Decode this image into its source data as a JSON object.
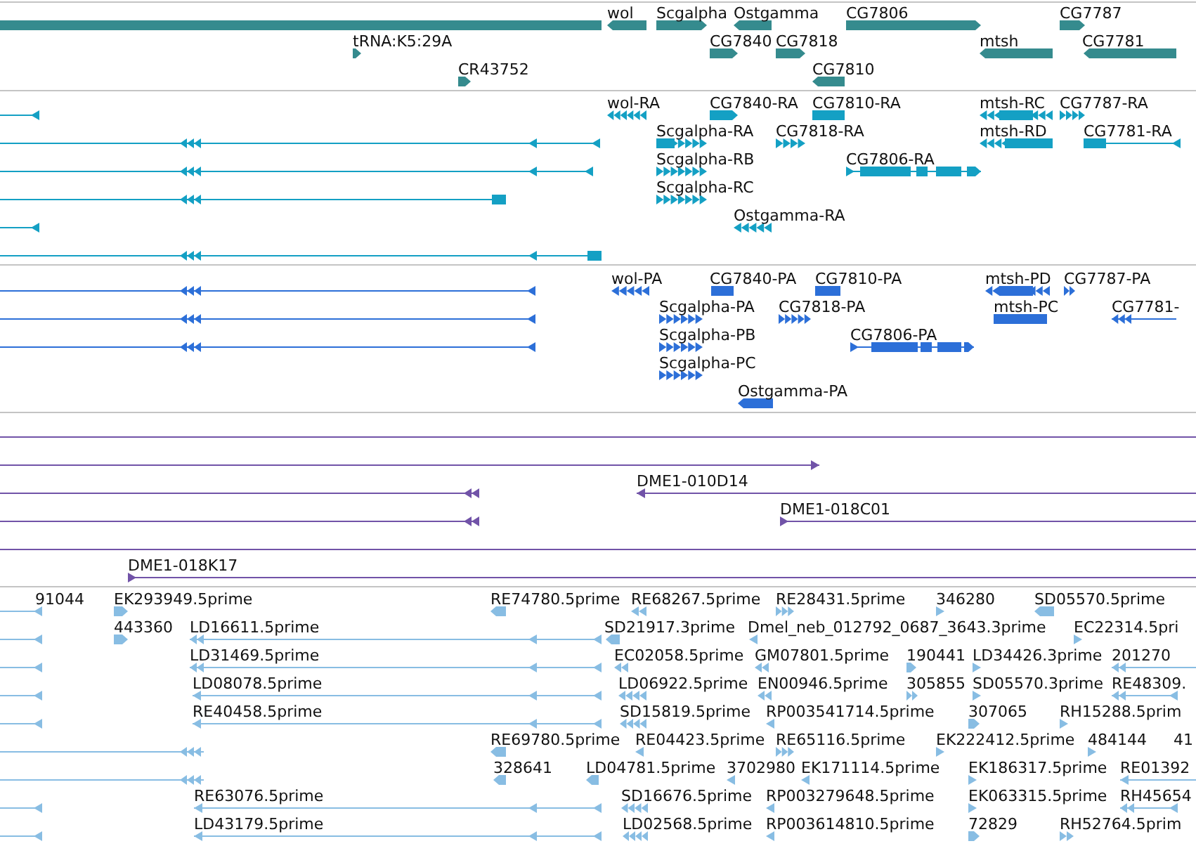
{
  "tracks": [
    {
      "color": "#358b8e",
      "labels": [
        "wol",
        "Scgalpha",
        "Ostgamma",
        "CG7806",
        "CG7787",
        "tRNA:K5:29A",
        "CG7840",
        "CG7818",
        "mtsh",
        "CG7781",
        "CR43752",
        "CG7810"
      ]
    },
    {
      "color": "#14a0c4",
      "labels": [
        "wol-RA",
        "CG7840-RA",
        "CG7810-RA",
        "mtsh-RC",
        "CG7787-RA",
        "Scgalpha-RA",
        "CG7818-RA",
        "mtsh-RD",
        "CG7781-RA",
        "Scgalpha-RB",
        "CG7806-RA",
        "Scgalpha-RC",
        "Ostgamma-RA"
      ]
    },
    {
      "color": "#2c6fd8",
      "labels": [
        "wol-PA",
        "CG7840-PA",
        "CG7810-PA",
        "mtsh-PD",
        "CG7787-PA",
        "Scgalpha-PA",
        "CG7818-PA",
        "mtsh-PC",
        "CG7781-",
        "Scgalpha-PB",
        "CG7806-PA",
        "Scgalpha-PC",
        "Ostgamma-PA"
      ]
    },
    {
      "color": "#7153a8",
      "labels": [
        "DME1-010D14",
        "DME1-018C01",
        "DME1-018K17"
      ]
    },
    {
      "color": "#88bde3",
      "labels": [
        "91044",
        "EK293949.5prime",
        "RE74780.5prime",
        "RE68267.5prime",
        "RE28431.5prime",
        "346280",
        "SD05570.5prime",
        "443360",
        "LD16611.5prime",
        "SD21917.3prime",
        "Dmel_neb_012792_0687_3643.3prime",
        "EC22314.5pri",
        "LD31469.5prime",
        "EC02058.5prime",
        "GM07801.5prime",
        "190441",
        "LD34426.3prime",
        "201270",
        "LD08078.5prime",
        "LD06922.5prime",
        "EN00946.5prime",
        "305855",
        "SD05570.3prime",
        "RE48309.",
        "RE40458.5prime",
        "SD15819.5prime",
        "RP003541714.5prime",
        "307065",
        "RH15288.5prim",
        "RE69780.5prime",
        "RE04423.5prime",
        "RE65116.5prime",
        "EK222412.5prime",
        "484144",
        "41",
        "328641",
        "LD04781.5prime",
        "3702980",
        "EK171114.5prime",
        "EK186317.5prime",
        "RE01392",
        "RE63076.5prime",
        "SD16676.5prime",
        "RP003279648.5prime",
        "EK063315.5prime",
        "RH45654",
        "LD43179.5prime",
        "LD02568.5prime",
        "RP003614810.5prime",
        "72829",
        "RH52764.5prim"
      ]
    }
  ]
}
